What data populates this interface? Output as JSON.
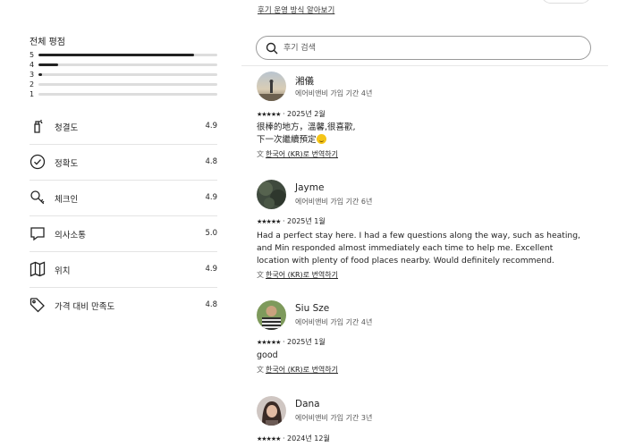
{
  "top": {
    "policy_link": "후기 운영 방식 알아보기"
  },
  "overall": {
    "title": "전체 평점",
    "distribution": [
      {
        "stars": "5",
        "fraction": 0.87
      },
      {
        "stars": "4",
        "fraction": 0.11
      },
      {
        "stars": "3",
        "fraction": 0.02
      },
      {
        "stars": "2",
        "fraction": 0.0
      },
      {
        "stars": "1",
        "fraction": 0.0
      }
    ]
  },
  "categories": [
    {
      "label": "청결도",
      "score": "4.9",
      "icon": "spray-bottle-icon"
    },
    {
      "label": "정확도",
      "score": "4.8",
      "icon": "check-circle-icon"
    },
    {
      "label": "체크인",
      "score": "4.9",
      "icon": "key-icon"
    },
    {
      "label": "의사소통",
      "score": "5.0",
      "icon": "chat-bubble-icon"
    },
    {
      "label": "위치",
      "score": "4.9",
      "icon": "map-icon"
    },
    {
      "label": "가격 대비 만족도",
      "score": "4.8",
      "icon": "price-tag-icon"
    }
  ],
  "search": {
    "placeholder": "후기 검색"
  },
  "reviews": [
    {
      "name": "湘儀",
      "tenure": "에어비앤비 가입 기간 4년",
      "stars": "★★★★★",
      "date": "2025년 2월",
      "body_line1": "很棒的地方，溫馨,很喜歡,",
      "body_line2": "下一次繼續預定",
      "translate": "한국어 (KR)로 번역하기"
    },
    {
      "name": "Jayme",
      "tenure": "에어비앤비 가입 기간 6년",
      "stars": "★★★★★",
      "date": "2025년 1월",
      "body": "Had a perfect stay here. I had a few questions along the way, such as heating, and Min responded almost immediately each time to help me. Excellent location with plenty of food places nearby. Would definitely recommend.",
      "translate": "한국어 (KR)로 번역하기"
    },
    {
      "name": "Siu Sze",
      "tenure": "에어비앤비 가입 기간 4년",
      "stars": "★★★★★",
      "date": "2025년 1월",
      "body": "good",
      "translate": "한국어 (KR)로 번역하기"
    },
    {
      "name": "Dana",
      "tenure": "에어비앤비 가입 기간 3년",
      "stars": "★★★★★",
      "date": "2024년 12월"
    }
  ],
  "colors": {
    "text": "#222222",
    "muted": "#555555",
    "bar_track": "#dddddd",
    "divider": "#e4e4e4"
  }
}
